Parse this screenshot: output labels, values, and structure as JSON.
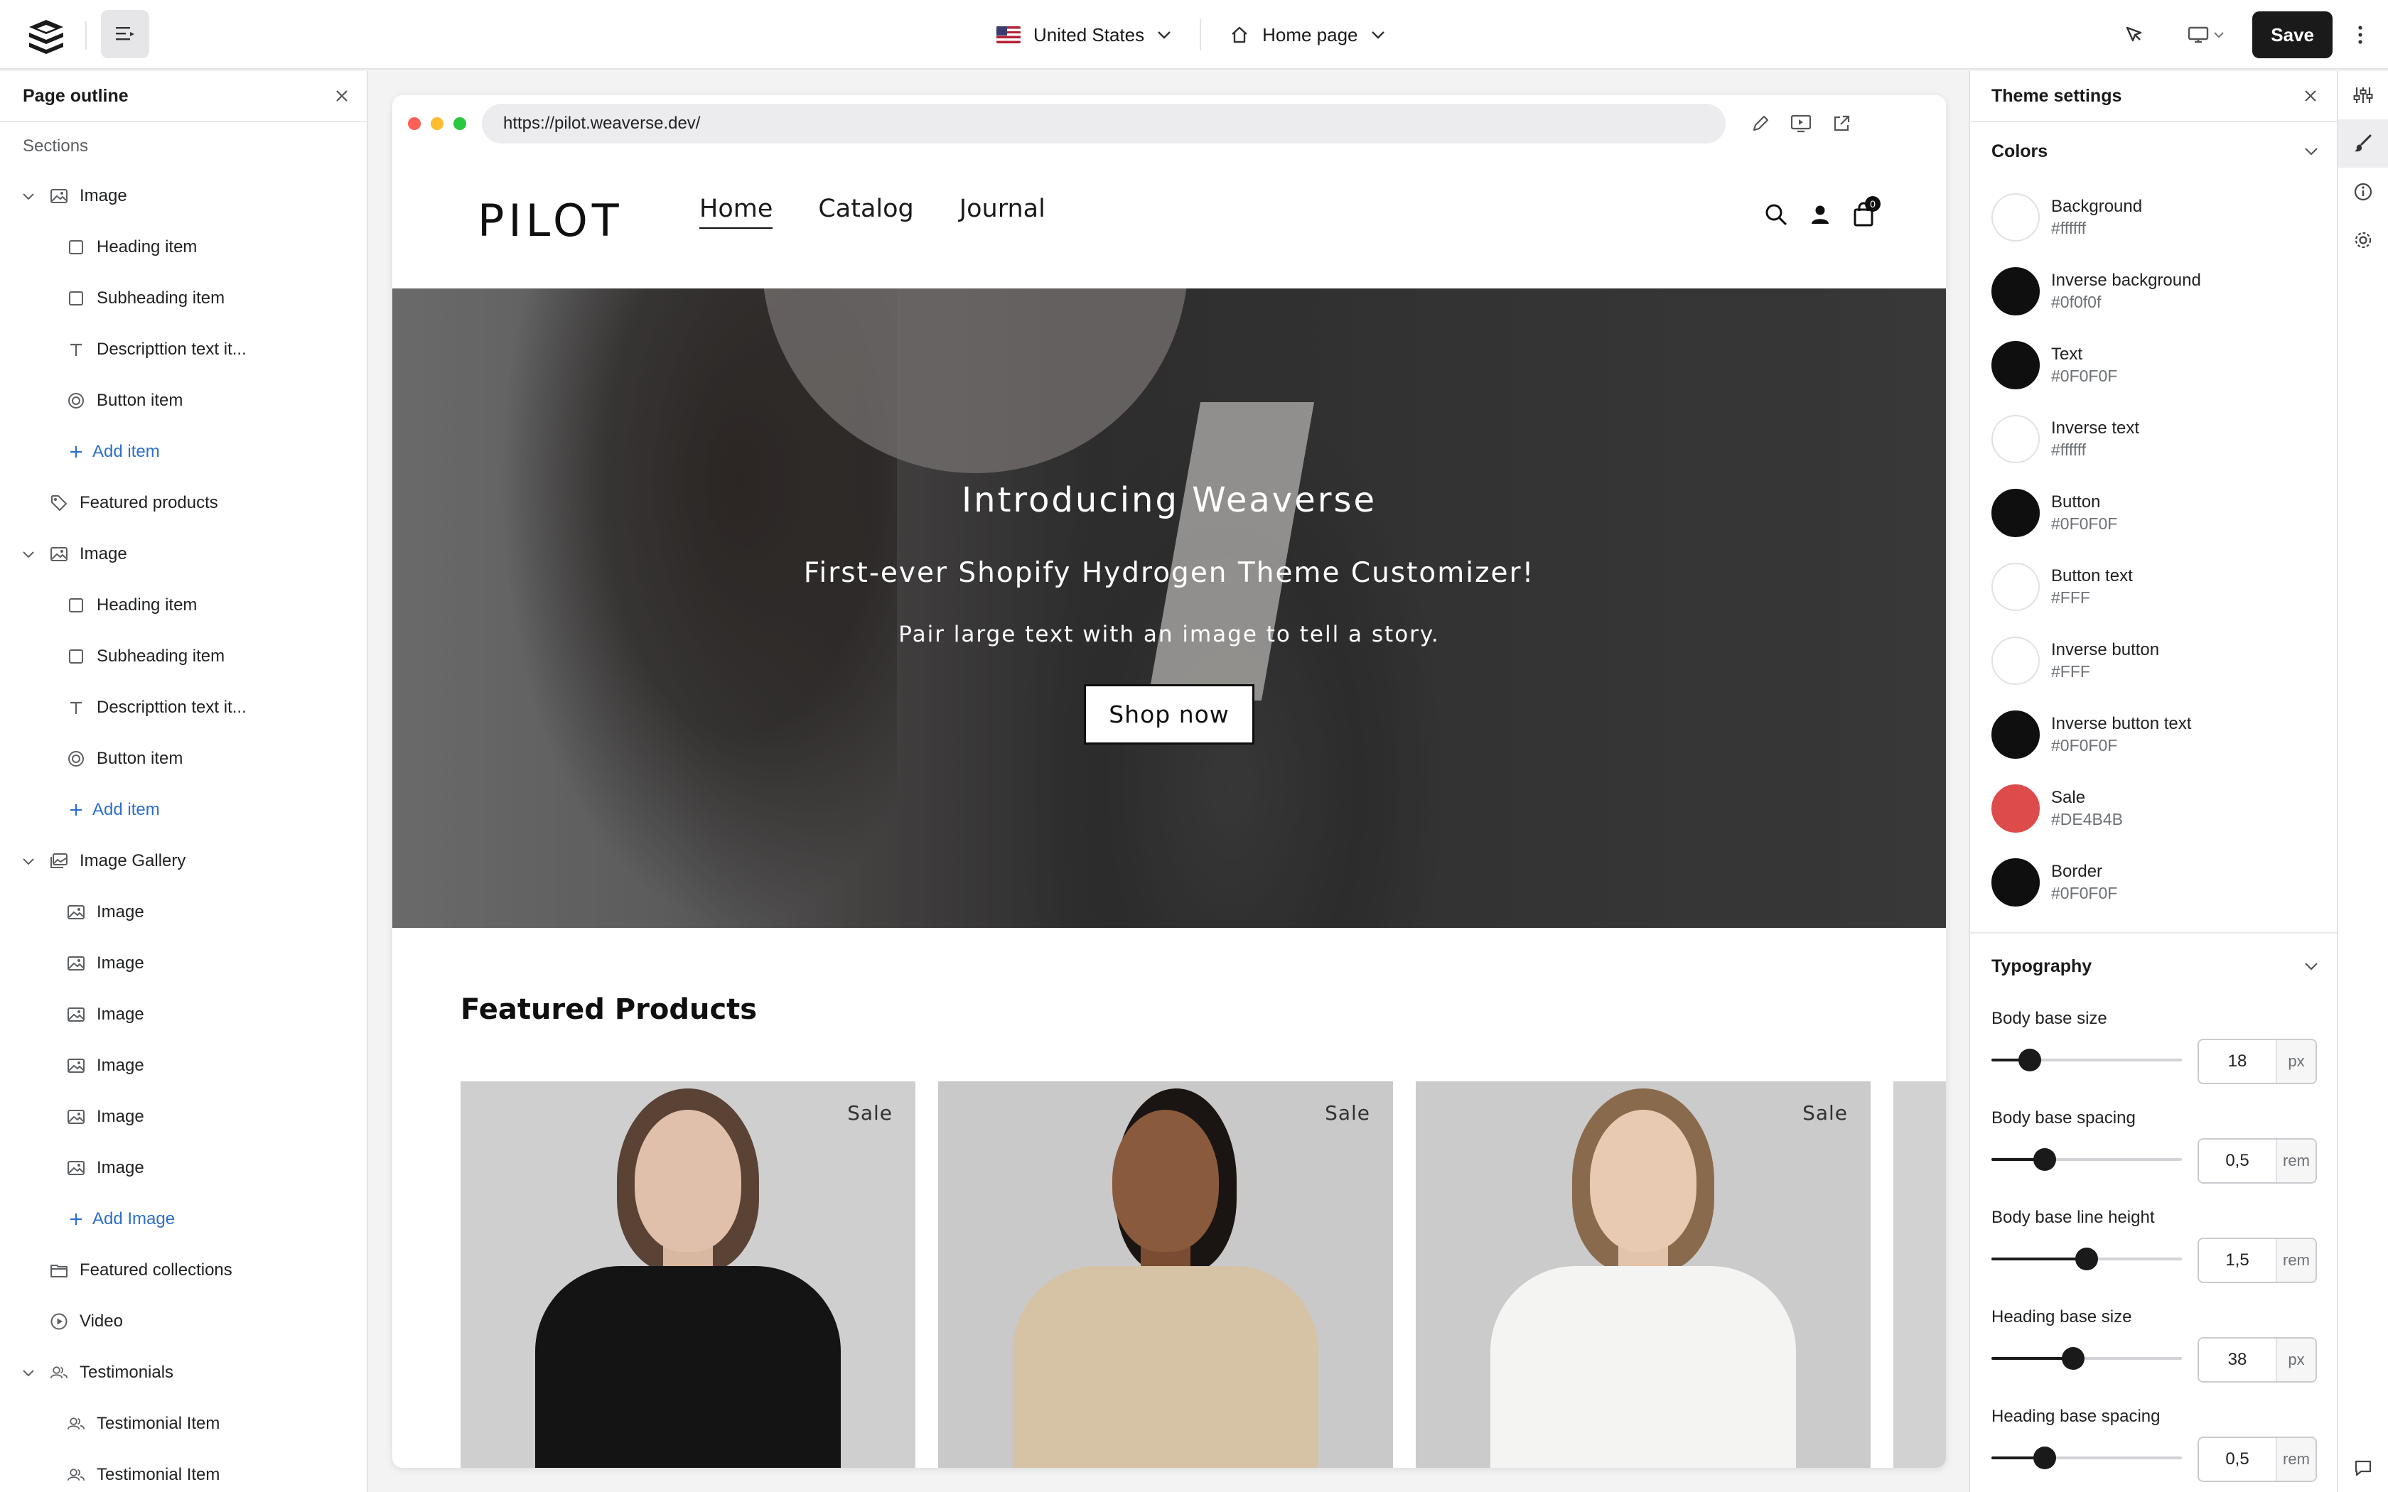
{
  "topbar": {
    "country": "United States",
    "page": "Home page",
    "save_label": "Save"
  },
  "left_panel": {
    "title": "Page outline",
    "sections_label": "Sections",
    "rows": [
      {
        "level": 0,
        "label": "Image",
        "icon": "image-icon",
        "collapsible": true
      },
      {
        "level": 1,
        "label": "Heading item",
        "icon": "square-icon"
      },
      {
        "level": 1,
        "label": "Subheading item",
        "icon": "square-icon"
      },
      {
        "level": 1,
        "label": "Descripttion text it...",
        "icon": "text-icon"
      },
      {
        "level": 1,
        "label": "Button item",
        "icon": "button-icon"
      },
      {
        "level": 1,
        "label": "Add item",
        "icon": "plus-icon",
        "add": true
      },
      {
        "level": 0,
        "label": "Featured products",
        "icon": "tag-icon"
      },
      {
        "level": 0,
        "label": "Image",
        "icon": "image-icon",
        "collapsible": true
      },
      {
        "level": 1,
        "label": "Heading item",
        "icon": "square-icon"
      },
      {
        "level": 1,
        "label": "Subheading item",
        "icon": "square-icon"
      },
      {
        "level": 1,
        "label": "Descripttion text it...",
        "icon": "text-icon"
      },
      {
        "level": 1,
        "label": "Button item",
        "icon": "button-icon"
      },
      {
        "level": 1,
        "label": "Add item",
        "icon": "plus-icon",
        "add": true
      },
      {
        "level": 0,
        "label": "Image Gallery",
        "icon": "gallery-icon",
        "collapsible": true
      },
      {
        "level": 1,
        "label": "Image",
        "icon": "image-icon"
      },
      {
        "level": 1,
        "label": "Image",
        "icon": "image-icon"
      },
      {
        "level": 1,
        "label": "Image",
        "icon": "image-icon"
      },
      {
        "level": 1,
        "label": "Image",
        "icon": "image-icon"
      },
      {
        "level": 1,
        "label": "Image",
        "icon": "image-icon"
      },
      {
        "level": 1,
        "label": "Image",
        "icon": "image-icon"
      },
      {
        "level": 1,
        "label": "Add Image",
        "icon": "plus-icon",
        "add": true
      },
      {
        "level": 0,
        "label": "Featured collections",
        "icon": "folder-icon"
      },
      {
        "level": 0,
        "label": "Video",
        "icon": "play-icon"
      },
      {
        "level": 0,
        "label": "Testimonials",
        "icon": "users-icon",
        "collapsible": true
      },
      {
        "level": 1,
        "label": "Testimonial Item",
        "icon": "users-icon"
      },
      {
        "level": 1,
        "label": "Testimonial Item",
        "icon": "users-icon"
      }
    ]
  },
  "browser": {
    "url": "https://pilot.weaverse.dev/"
  },
  "site": {
    "logo": "PILOT",
    "nav": [
      "Home",
      "Catalog",
      "Journal"
    ],
    "cart_count": "0",
    "hero": {
      "title": "Introducing Weaverse",
      "subtitle": "First-ever Shopify Hydrogen Theme Customizer!",
      "description": "Pair large text with an image to tell a story.",
      "button": "Shop now"
    },
    "featured_title": "Featured Products",
    "sale_label": "Sale"
  },
  "right_panel": {
    "title": "Theme settings",
    "colors_title": "Colors",
    "colors": [
      {
        "name": "Background",
        "value": "#ffffff",
        "hex": "#ffffff"
      },
      {
        "name": "Inverse background",
        "value": "#0f0f0f",
        "hex": "#0f0f0f"
      },
      {
        "name": "Text",
        "value": "#0F0F0F",
        "hex": "#0f0f0f"
      },
      {
        "name": "Inverse text",
        "value": "#ffffff",
        "hex": "#ffffff"
      },
      {
        "name": "Button",
        "value": "#0F0F0F",
        "hex": "#0f0f0f"
      },
      {
        "name": "Button text",
        "value": "#FFF",
        "hex": "#ffffff"
      },
      {
        "name": "Inverse button",
        "value": "#FFF",
        "hex": "#ffffff"
      },
      {
        "name": "Inverse button text",
        "value": "#0F0F0F",
        "hex": "#0f0f0f"
      },
      {
        "name": "Sale",
        "value": "#DE4B4B",
        "hex": "#de4b4b"
      },
      {
        "name": "Border",
        "value": "#0F0F0F",
        "hex": "#0f0f0f"
      }
    ],
    "typography_title": "Typography",
    "typography": [
      {
        "label": "Body base size",
        "value": "18",
        "unit": "px",
        "level": 0.2
      },
      {
        "label": "Body base spacing",
        "value": "0,5",
        "unit": "rem",
        "level": 0.28
      },
      {
        "label": "Body base line height",
        "value": "1,5",
        "unit": "rem",
        "level": 0.5
      },
      {
        "label": "Heading base size",
        "value": "38",
        "unit": "px",
        "level": 0.43
      },
      {
        "label": "Heading base spacing",
        "value": "0,5",
        "unit": "rem",
        "level": 0.28
      }
    ]
  },
  "colors": {
    "accent": "#2c6ecb",
    "dark": "#1a1a1a"
  }
}
